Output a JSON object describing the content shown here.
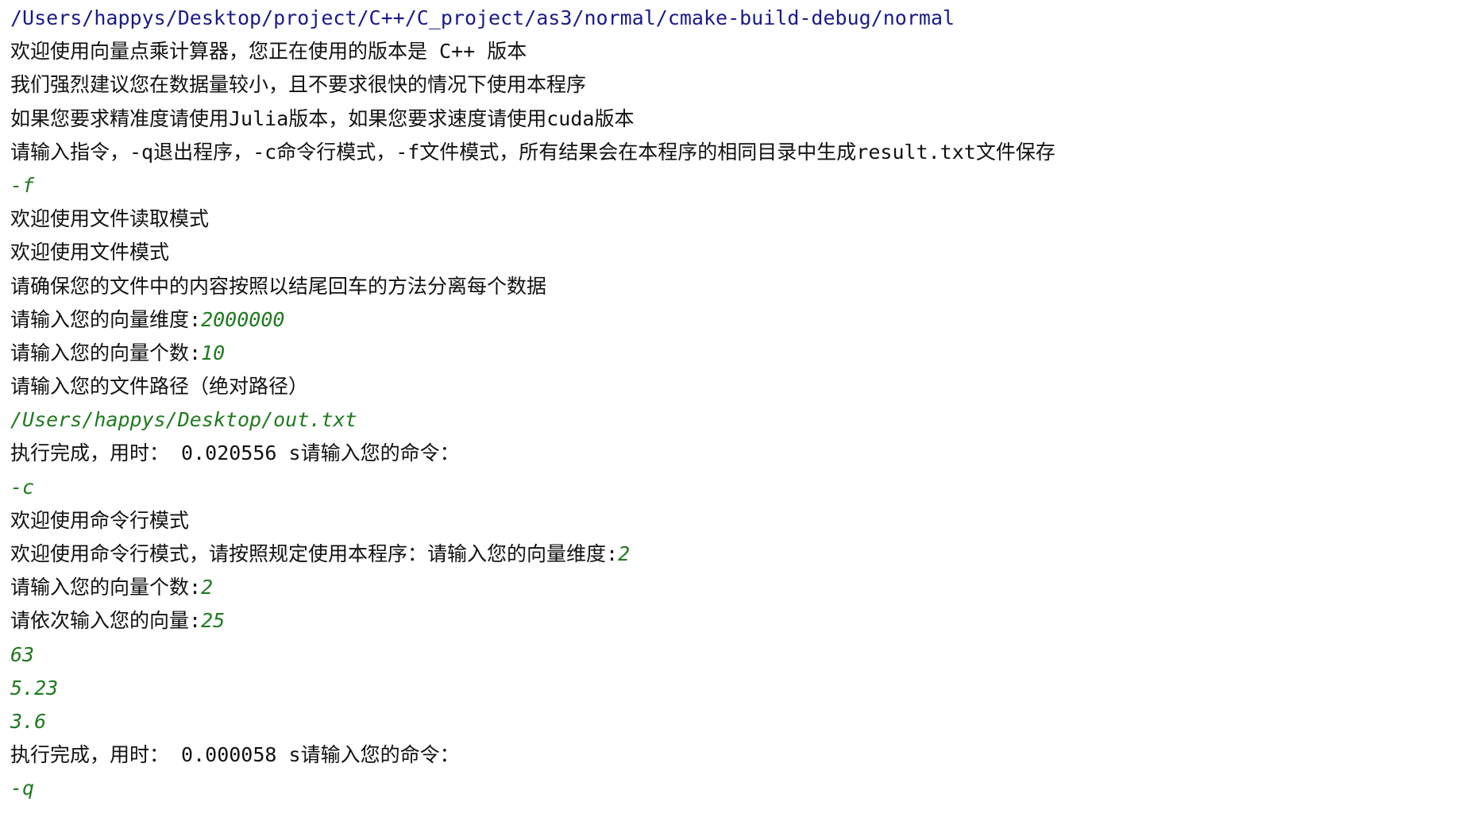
{
  "console": {
    "lines": [
      {
        "type": "path",
        "text": "/Users/happys/Desktop/project/C++/C_project/as3/normal/cmake-build-debug/normal"
      },
      {
        "type": "output",
        "text": "欢迎使用向量点乘计算器，您正在使用的版本是 C++ 版本"
      },
      {
        "type": "output",
        "text": "我们强烈建议您在数据量较小，且不要求很快的情况下使用本程序"
      },
      {
        "type": "output",
        "text": "如果您要求精准度请使用Julia版本，如果您要求速度请使用cuda版本"
      },
      {
        "type": "output",
        "text": "请输入指令，-q退出程序，-c命令行模式，-f文件模式，所有结果会在本程序的相同目录中生成result.txt文件保存"
      },
      {
        "type": "input",
        "text": "-f"
      },
      {
        "type": "output",
        "text": "欢迎使用文件读取模式"
      },
      {
        "type": "output",
        "text": "欢迎使用文件模式"
      },
      {
        "type": "output",
        "text": "请确保您的文件中的内容按照以结尾回车的方法分离每个数据"
      },
      {
        "type": "prompt",
        "text": "请输入您的向量维度:",
        "input": "2000000"
      },
      {
        "type": "prompt",
        "text": "请输入您的向量个数:",
        "input": "10"
      },
      {
        "type": "output",
        "text": "请输入您的文件路径（绝对路径）"
      },
      {
        "type": "input",
        "text": "/Users/happys/Desktop/out.txt"
      },
      {
        "type": "output",
        "text": "执行完成，用时： 0.020556 s请输入您的命令："
      },
      {
        "type": "input",
        "text": "-c"
      },
      {
        "type": "output",
        "text": "欢迎使用命令行模式"
      },
      {
        "type": "prompt",
        "text": "欢迎使用命令行模式，请按照规定使用本程序：请输入您的向量维度:",
        "input": "2"
      },
      {
        "type": "prompt",
        "text": "请输入您的向量个数:",
        "input": "2"
      },
      {
        "type": "prompt",
        "text": "请依次输入您的向量:",
        "input": "25"
      },
      {
        "type": "input",
        "text": "63"
      },
      {
        "type": "input",
        "text": "5.23"
      },
      {
        "type": "input",
        "text": "3.6"
      },
      {
        "type": "output",
        "text": "执行完成，用时： 0.000058 s请输入您的命令："
      },
      {
        "type": "input",
        "text": "-q"
      }
    ]
  },
  "colors": {
    "background": "#ffffff",
    "output_text": "#111111",
    "path_text": "#1a1a8a",
    "input_text": "#1f7a1f"
  }
}
